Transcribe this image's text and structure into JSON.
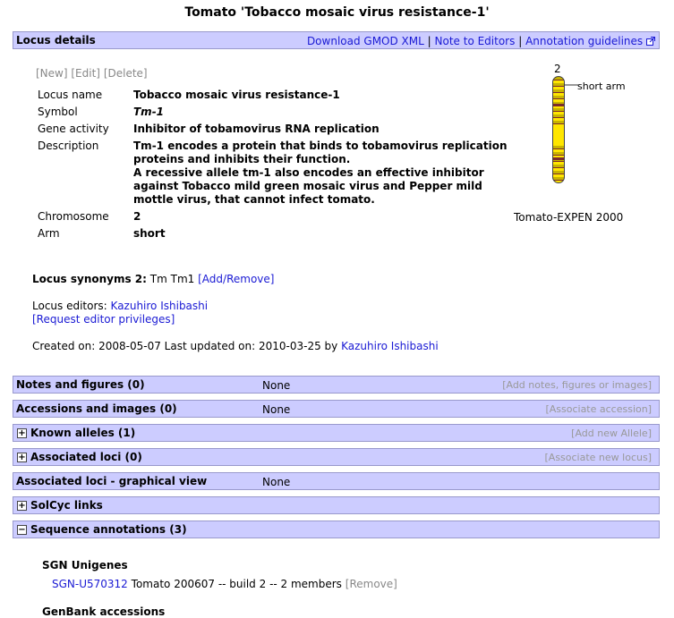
{
  "page_title": "Tomato 'Tobacco mosaic virus resistance-1'",
  "locus_details": {
    "title": "Locus details",
    "links": [
      "Download GMOD XML",
      "Note to Editors",
      "Annotation guidelines"
    ],
    "sep": "|"
  },
  "controls": {
    "new": "[New]",
    "edit": "[Edit]",
    "delete": "[Delete]"
  },
  "fields": {
    "locus_name_label": "Locus name",
    "locus_name": "Tobacco mosaic virus resistance-1",
    "symbol_label": "Symbol",
    "symbol": "Tm-1",
    "gene_activity_label": "Gene activity",
    "gene_activity": "Inhibitor of tobamovirus RNA replication",
    "description_label": "Description",
    "description_1": "Tm-1 encodes a protein that binds to tobamovirus replication",
    "description_2": "proteins and inhibits their function.",
    "description_3": "A recessive allele tm-1 also encodes an effective inhibitor",
    "description_4": "against Tobacco mild green mosaic virus and Pepper mild",
    "description_5": "mottle virus, that cannot infect tomato.",
    "chromosome_label": "Chromosome",
    "chromosome": "2",
    "arm_label": "Arm",
    "arm": "short"
  },
  "chromosome_figure": {
    "number": "2",
    "arm_label": "short arm",
    "map_name": "Tomato-EXPEN 2000",
    "band_colors": [
      "#c8b400",
      "#7b2c2c",
      "#ffe600"
    ]
  },
  "synonyms": {
    "label": "Locus synonyms 2:",
    "values": "Tm Tm1",
    "add_remove": "[Add/Remove]"
  },
  "editors": {
    "label": "Locus editors:",
    "name": "Kazuhiro Ishibashi",
    "request": "[Request editor privileges]"
  },
  "created": {
    "text": "Created on: 2008-05-07 Last updated on: 2010-03-25 by",
    "by": "Kazuhiro Ishibashi"
  },
  "sections": {
    "notes": {
      "title": "Notes and figures (0)",
      "status": "None",
      "action": "[Add notes, figures or images]"
    },
    "accessions": {
      "title": "Accessions and images (0)",
      "status": "None",
      "action": "[Associate accession]"
    },
    "alleles": {
      "title": "Known alleles (1)",
      "toggle": "+",
      "action": "[Add new Allele]"
    },
    "assoc_loci": {
      "title": "Associated loci (0)",
      "toggle": "+",
      "action": "[Associate new locus]"
    },
    "graphical": {
      "title": "Associated loci - graphical view",
      "status": "None"
    },
    "solcyc": {
      "title": "SolCyc links",
      "toggle": "+"
    },
    "seq_ann": {
      "title": "Sequence annotations (3)",
      "toggle": "−"
    }
  },
  "sgn_unigenes": {
    "heading": "SGN Unigenes",
    "id": "SGN-U570312",
    "desc": "Tomato 200607 -- build 2 -- 2 members",
    "remove": "[Remove]"
  },
  "genbank": {
    "heading": "GenBank accessions"
  }
}
